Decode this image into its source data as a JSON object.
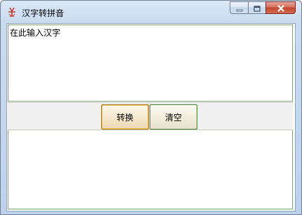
{
  "window": {
    "title": "汉字转拼音"
  },
  "icons": {
    "app": "app-logo-icon",
    "minimize": "minimize-icon",
    "maximize": "maximize-icon",
    "close": "close-icon"
  },
  "input": {
    "text": "在此输入汉字"
  },
  "buttons": {
    "convert_label": "转换",
    "clear_label": "清空"
  },
  "output": {
    "text": ""
  },
  "colors": {
    "close_button": "#c2452e",
    "focused_button_border": "#f2c65a",
    "field_border": "#7fa07a"
  }
}
